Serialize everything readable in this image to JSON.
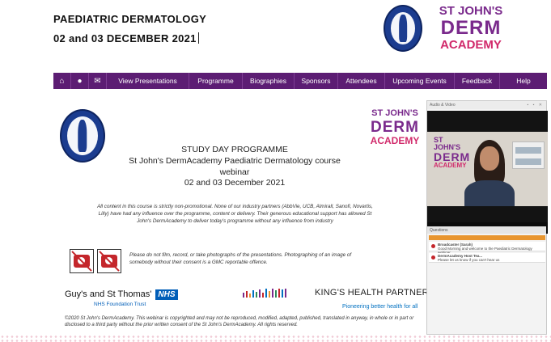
{
  "header": {
    "title": "PAEDIATRIC DERMATOLOGY",
    "date": "02 and 03 DECEMBER 2021"
  },
  "brand": {
    "line1": "ST JOHN'S",
    "line2": "DERM",
    "line3": "ACADEMY",
    "primary_color": "#7a2a8c",
    "accent_color": "#d12a6b"
  },
  "nav": {
    "icons": [
      "home-icon",
      "user-icon",
      "chat-icon"
    ],
    "items": [
      "View Presentations",
      "Programme",
      "Biographies",
      "Sponsors",
      "Attendees",
      "Upcoming Events",
      "Feedback",
      "Help"
    ],
    "bg_color": "#5c1d73"
  },
  "slide": {
    "heading": "STUDY DAY PROGRAMME",
    "course_line": "St John's DermAcademy Paediatric Dermatology course",
    "format": "webinar",
    "dates": "02 and 03 December 2021",
    "disclaimer": "All content in this course is strictly non-promotional. None of our industry partners (AbbVie, UCB, Almirall, Sanofi, Novartis, Lilly) have had any influence over the programme, content or delivery. Their generous educational support has allowed St John's DermAcademy to deliver today's programme without any influence from industry",
    "no_film_notice": "Please do not film, record, or take photographs of the presentations. Photographing of an image of somebody without their consent is a GMC reportable offence.",
    "guys": "Guy's and St Thomas'",
    "nhs": "NHS",
    "trust": "NHS Foundation Trust",
    "khp": "KING'S HEALTH PARTNERS",
    "khp_tagline": "Pioneering better health for all",
    "copyright": "©2020 St John's DermAcademy. This webinar is copyrighted and may not be reproduced, modified, adapted, published, translated in anyway, in whole or in part or disclosed to a third party without the prior written consent of the St John's DermAcademy. All rights reserved."
  },
  "video_panel": {
    "title": "Audio & Video",
    "questions_label": "Questions",
    "questions": [
      {
        "author": "Broadcaster (Sarah)",
        "text": "Good Morning and welcome to the Paediatric Dermatology webinar"
      },
      {
        "author": "DermAcademy Host Tea...",
        "text": "Please let us know if you can't hear us"
      }
    ]
  }
}
